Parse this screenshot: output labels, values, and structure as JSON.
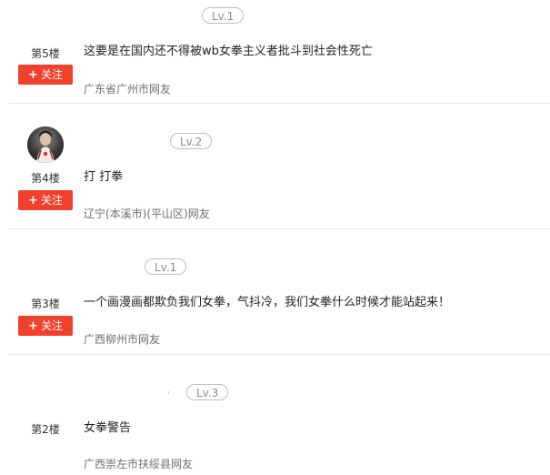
{
  "comments": [
    {
      "floor": "第5楼",
      "level": "Lv.1",
      "content": "这要是在国内还不得被wb女拳主义者批斗到社会性死亡",
      "location": "广东省广州市网友",
      "follow_label": "关注",
      "has_avatar": false
    },
    {
      "floor": "第4楼",
      "level": "Lv.2",
      "content": "打 打拳",
      "location": "辽宁(本溪市)(平山区)网友",
      "follow_label": "关注",
      "has_avatar": true
    },
    {
      "floor": "第3楼",
      "level": "Lv.1",
      "content": "一个画漫画都欺负我们女拳，气抖冷，我们女拳什么时候才能站起来！",
      "location": "广西柳州市网友",
      "follow_label": "关注",
      "has_avatar": false
    },
    {
      "floor": "第2楼",
      "level": "Lv.3",
      "content": "女拳警告",
      "location": "广西崇左市扶绥县网友",
      "follow_label": "",
      "has_avatar": false
    }
  ],
  "colors": {
    "follow_button_bg": "#f0412c",
    "divider": "#e6e6e6",
    "level_border": "#bdbdbd",
    "location_text": "#6f6f6f"
  },
  "icons": {
    "follow": "plus-icon",
    "avatar": "user-avatar"
  }
}
